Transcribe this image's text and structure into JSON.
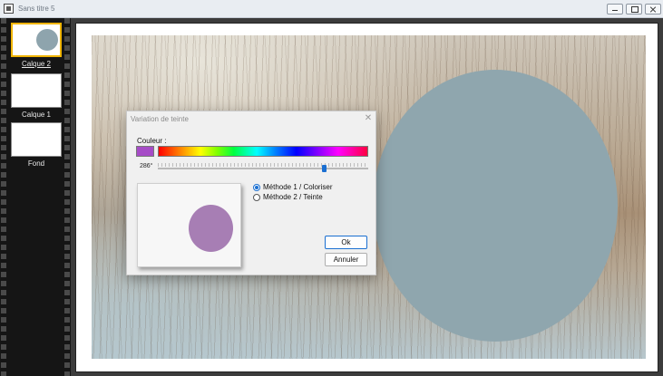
{
  "window": {
    "title": "Sans titre 5"
  },
  "layers": [
    {
      "label": "Calque 2",
      "selected": true
    },
    {
      "label": "Calque 1",
      "selected": false
    },
    {
      "label": "Fond",
      "selected": false
    }
  ],
  "dialog": {
    "title": "Variation de teinte",
    "color_label": "Couleur :",
    "swatch_color": "#a64cc7",
    "hue_value": "286°",
    "hue_fraction": 0.79,
    "preview_color": "#a77eb4",
    "options": [
      {
        "label": "Méthode 1 / Coloriser",
        "checked": true
      },
      {
        "label": "Méthode 2 / Teinte",
        "checked": false
      }
    ],
    "ok_label": "Ok",
    "cancel_label": "Annuler"
  },
  "colors": {
    "circle": "#8fa6ae",
    "accent": "#1a6fd1",
    "selected_layer": "#f0b400"
  }
}
